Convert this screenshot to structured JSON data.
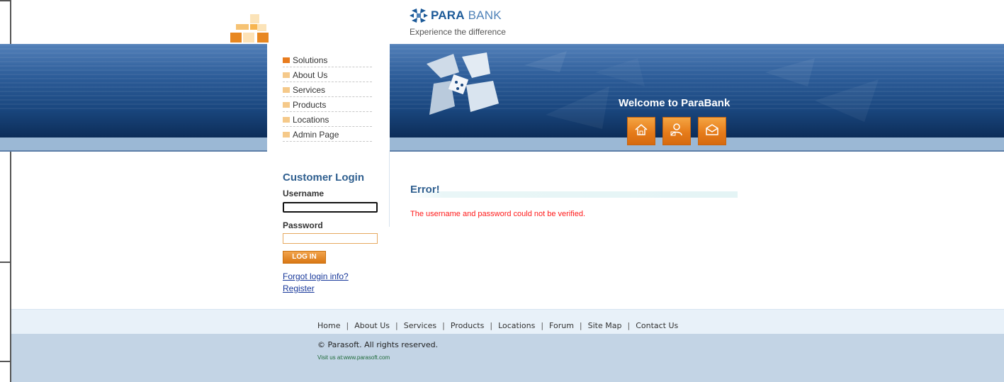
{
  "header": {
    "brand_bold": "PARA",
    "brand_light": " BANK",
    "tagline": "Experience the difference",
    "welcome": "Welcome to ParaBank",
    "buttons": [
      {
        "icon": "home-icon"
      },
      {
        "icon": "about-icon"
      },
      {
        "icon": "contact-icon"
      }
    ]
  },
  "menu": {
    "items": [
      {
        "label": "Solutions"
      },
      {
        "label": "About Us"
      },
      {
        "label": "Services"
      },
      {
        "label": "Products"
      },
      {
        "label": "Locations"
      },
      {
        "label": "Admin Page"
      }
    ]
  },
  "login": {
    "title": "Customer Login",
    "username_label": "Username",
    "username_value": "",
    "password_label": "Password",
    "password_value": "",
    "button": "LOG IN",
    "forgot": "Forgot login info?",
    "register": "Register"
  },
  "main": {
    "error_title": "Error!",
    "error_message": "The username and password could not be verified."
  },
  "footer": {
    "links": [
      "Home",
      "About Us",
      "Services",
      "Products",
      "Locations",
      "Forum",
      "Site Map",
      "Contact Us"
    ],
    "copyright": "© Parasoft. All rights reserved.",
    "visit": "Visit us at:www.parasoft.com"
  },
  "colors": {
    "brand_blue": "#1c5a98",
    "accent_orange": "#e87c1e",
    "error_red": "#ff1a1a",
    "heading_blue": "#2f5f8f"
  }
}
